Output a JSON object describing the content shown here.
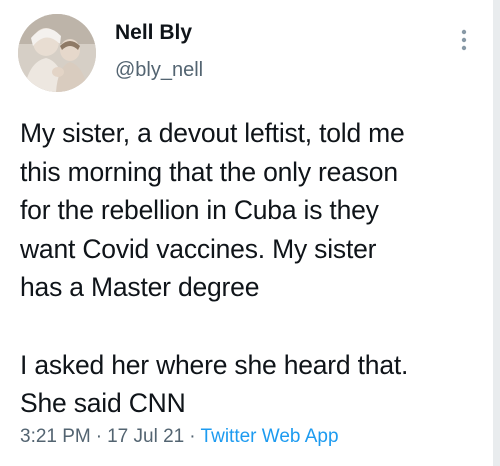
{
  "tweet": {
    "author": {
      "display_name": "Nell Bly",
      "handle": "@bly_nell"
    },
    "more_icon": "vertical-ellipsis-icon",
    "text": "My sister, a devout leftist, told me\nthis morning that the only reason\nfor the rebellion in Cuba is they\nwant Covid vaccines. My sister\nhas a Master degree\n\nI asked her where she heard that.\nShe said CNN",
    "time": "3:21 PM",
    "date": "17 Jul 21",
    "separator": "·",
    "source": "Twitter Web App"
  },
  "colors": {
    "text": "#0f1419",
    "secondary": "#536471",
    "link": "#1d9bf0"
  }
}
